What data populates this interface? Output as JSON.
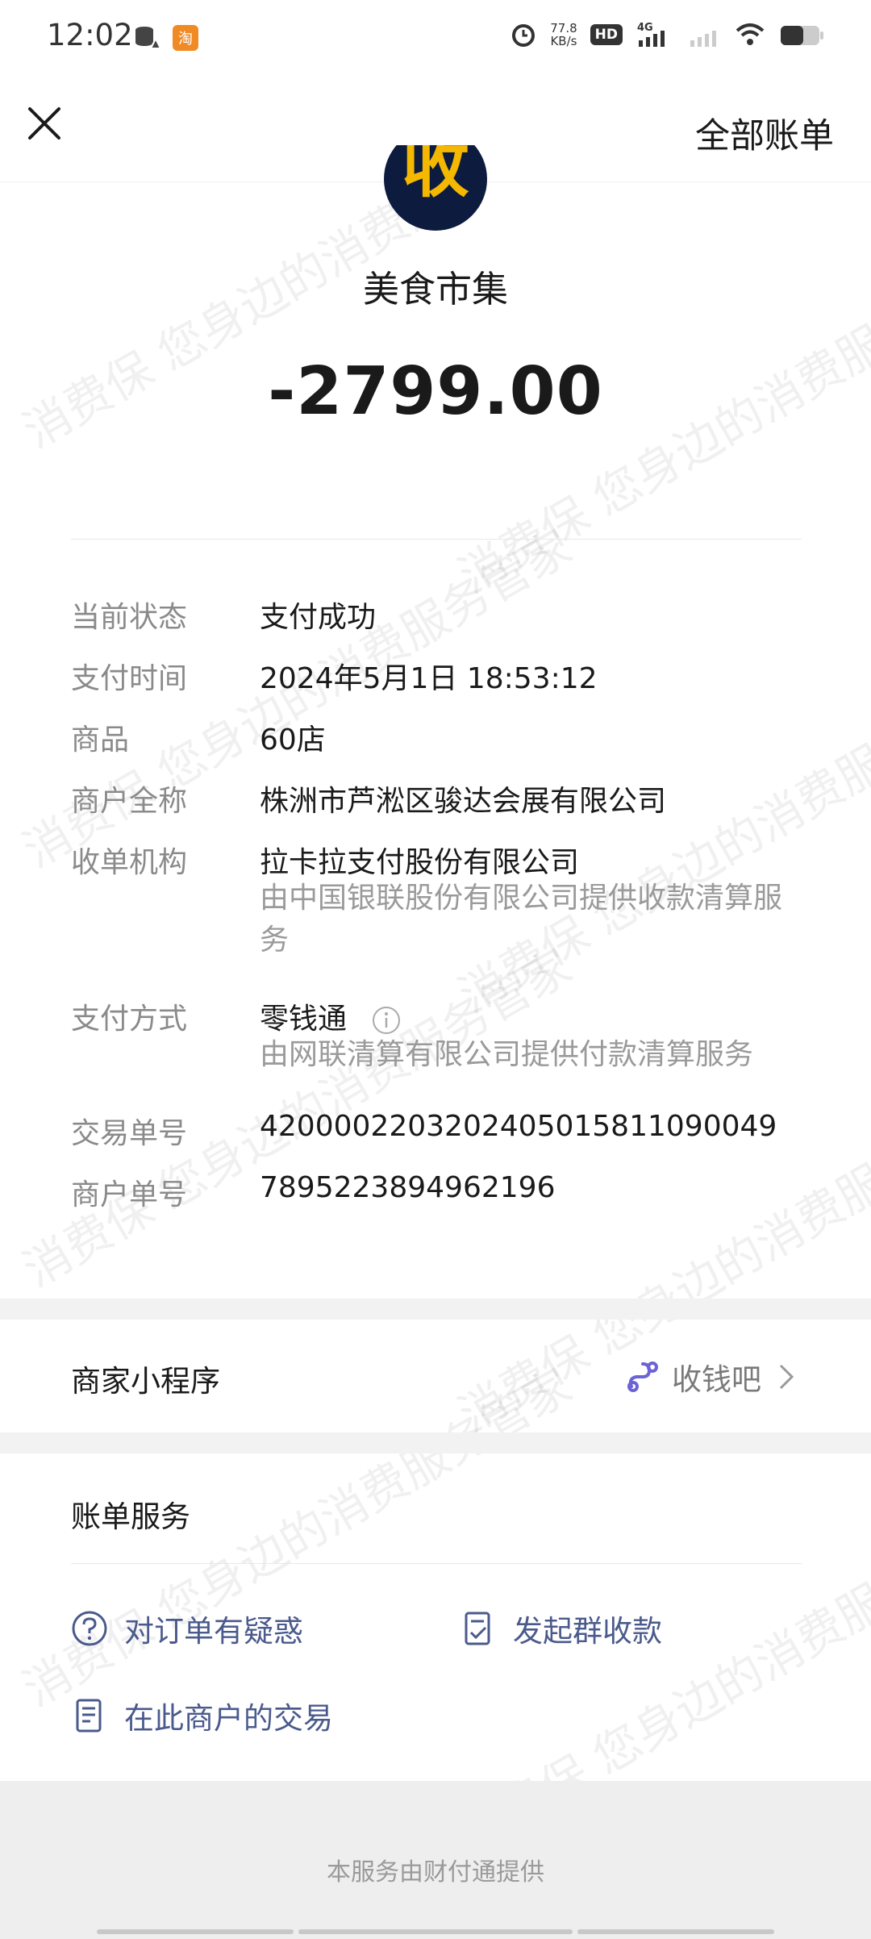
{
  "status_bar": {
    "time": "12:02",
    "speed_value": "77.8",
    "speed_unit": "KB/s",
    "hd_label": "HD",
    "network_label": "4G"
  },
  "header": {
    "all_bills_label": "全部账单"
  },
  "merchant": {
    "logo_char": "收",
    "name": "美食市集",
    "amount": "-2799.00"
  },
  "details": [
    {
      "label": "当前状态",
      "value": "支付成功"
    },
    {
      "label": "支付时间",
      "value": "2024年5月1日 18:53:12"
    },
    {
      "label": "商品",
      "value": "60店"
    },
    {
      "label": "商户全称",
      "value": "株洲市芦淞区骏达会展有限公司"
    },
    {
      "label": "收单机构",
      "value": "拉卡拉支付股份有限公司",
      "sub": "由中国银联股份有限公司提供收款清算服务"
    },
    {
      "label": "支付方式",
      "value": "零钱通",
      "sub": "由网联清算有限公司提供付款清算服务"
    },
    {
      "label": "交易单号",
      "value": "4200002203202405015811090049"
    },
    {
      "label": "商户单号",
      "value": "7895223894962196"
    }
  ],
  "mini_program": {
    "title": "商家小程序",
    "name": "收钱吧"
  },
  "bill_services": {
    "title": "账单服务",
    "items": [
      {
        "label": "对订单有疑惑",
        "icon": "question-icon"
      },
      {
        "label": "发起群收款",
        "icon": "group-collect-icon"
      },
      {
        "label": "在此商户的交易",
        "icon": "document-icon"
      }
    ]
  },
  "footer": {
    "text": "本服务由财付通提供"
  },
  "watermark": {
    "text": "消费保 您身边的消费服务管家"
  },
  "colors": {
    "link_blue": "#4a5a8c",
    "logo_bg": "#0d1b3f",
    "logo_char": "#f5b800",
    "label_gray": "#8a8a8a"
  }
}
